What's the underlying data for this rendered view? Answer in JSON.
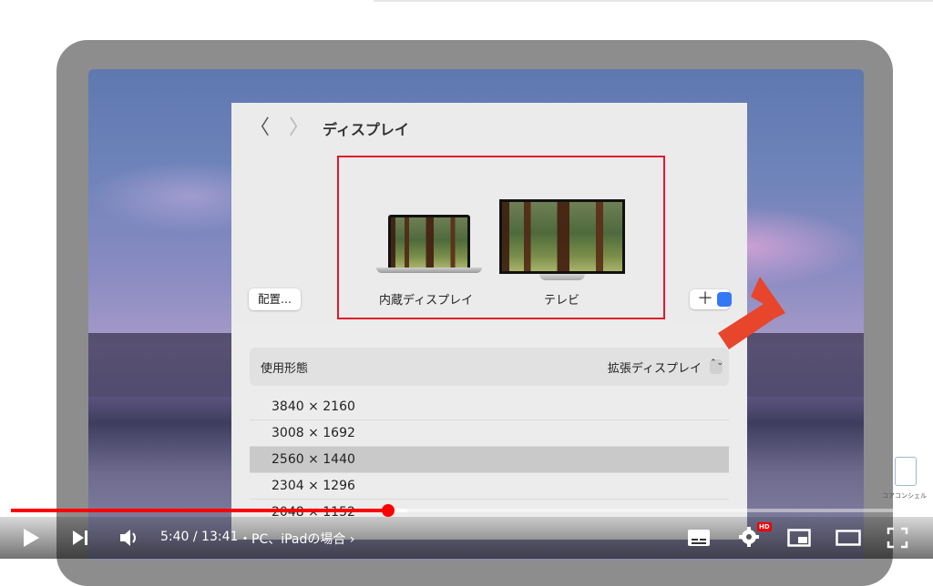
{
  "window": {
    "title": "ディスプレイ",
    "back_glyph": "〈",
    "forward_glyph": "〉"
  },
  "displays": {
    "arrange_label": "配置...",
    "internal_label": "内蔵ディスプレイ",
    "tv_label": "テレビ",
    "add_label": "＋"
  },
  "usage": {
    "label": "使用形態",
    "value": "拡張ディスプレイ",
    "stepper_glyph": "⌃⌄"
  },
  "resolutions": [
    {
      "label": "3840 × 2160",
      "selected": false
    },
    {
      "label": "3008 × 1692",
      "selected": false
    },
    {
      "label": "2560 × 1440",
      "selected": true
    },
    {
      "label": "2304 × 1296",
      "selected": false
    },
    {
      "label": "2048 × 1152",
      "selected": false
    }
  ],
  "watermark": {
    "text": "コアコンシェル"
  },
  "player": {
    "time": "5:40 / 13:41",
    "chapter": "・PC、iPadの場合 ›",
    "hd_badge": "HD",
    "progress": 0.407
  },
  "colors": {
    "highlight": "#e01a2c",
    "arrow": "#e8452d",
    "progress": "#ff0000"
  }
}
